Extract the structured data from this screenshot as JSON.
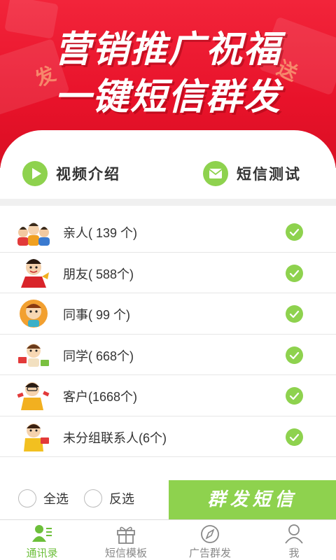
{
  "banner": {
    "line1": "营销推广祝福",
    "line2": "一键短信群发",
    "deco_left": "发",
    "deco_right": "送"
  },
  "quick_actions": [
    {
      "icon": "play-icon",
      "label": "视频介绍"
    },
    {
      "icon": "mail-icon",
      "label": "短信测试"
    }
  ],
  "groups": [
    {
      "label": "亲人( 139 个)",
      "avatar": "family-avatar-icon",
      "checked": true
    },
    {
      "label": "朋友( 588个)",
      "avatar": "friend-avatar-icon",
      "checked": true
    },
    {
      "label": "同事(  99 个)",
      "avatar": "colleague-avatar-icon",
      "checked": true
    },
    {
      "label": "同学( 668个)",
      "avatar": "classmate-avatar-icon",
      "checked": true
    },
    {
      "label": "客户(1668个)",
      "avatar": "customer-avatar-icon",
      "checked": true
    },
    {
      "label": "未分组联系人(6个)",
      "avatar": "ungrouped-avatar-icon",
      "checked": true
    }
  ],
  "selection": {
    "select_all": "全选",
    "invert": "反选",
    "send_button": "群发短信"
  },
  "tabs": [
    {
      "label": "通讯录",
      "icon": "contacts-icon",
      "active": true
    },
    {
      "label": "短信模板",
      "icon": "gift-icon",
      "active": false
    },
    {
      "label": "广告群发",
      "icon": "compass-icon",
      "active": false
    },
    {
      "label": "我",
      "icon": "user-icon",
      "active": false
    }
  ],
  "colors": {
    "banner_red": "#e8122a",
    "accent_green": "#8ed24e",
    "active_tab_green": "#6cbf3a"
  }
}
